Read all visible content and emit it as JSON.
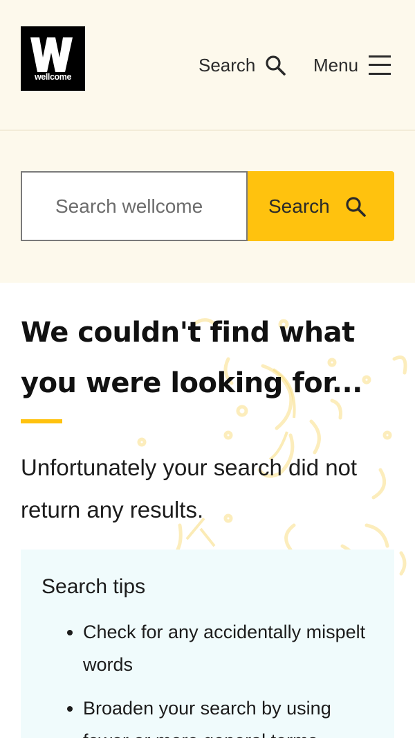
{
  "header": {
    "logo_text": "wellcome",
    "search_label": "Search",
    "menu_label": "Menu"
  },
  "search": {
    "placeholder": "Search wellcome",
    "button_label": "Search"
  },
  "main": {
    "title": "We couldn't find what you were looking for...",
    "lead": "Unfortunately your search did not return any results."
  },
  "tips": {
    "title": "Search tips",
    "items": [
      {
        "text": "Check for any accidentally mispelt words"
      },
      {
        "text": "Broaden your search by using fewer or more general terms"
      }
    ]
  },
  "colors": {
    "header_bg": "#fdf9ec",
    "accent_yellow": "#ffc20e",
    "tips_bg": "#f0fbfc",
    "logo_bg": "#000000"
  },
  "icons": {
    "search": "search-icon",
    "menu": "menu-icon"
  }
}
